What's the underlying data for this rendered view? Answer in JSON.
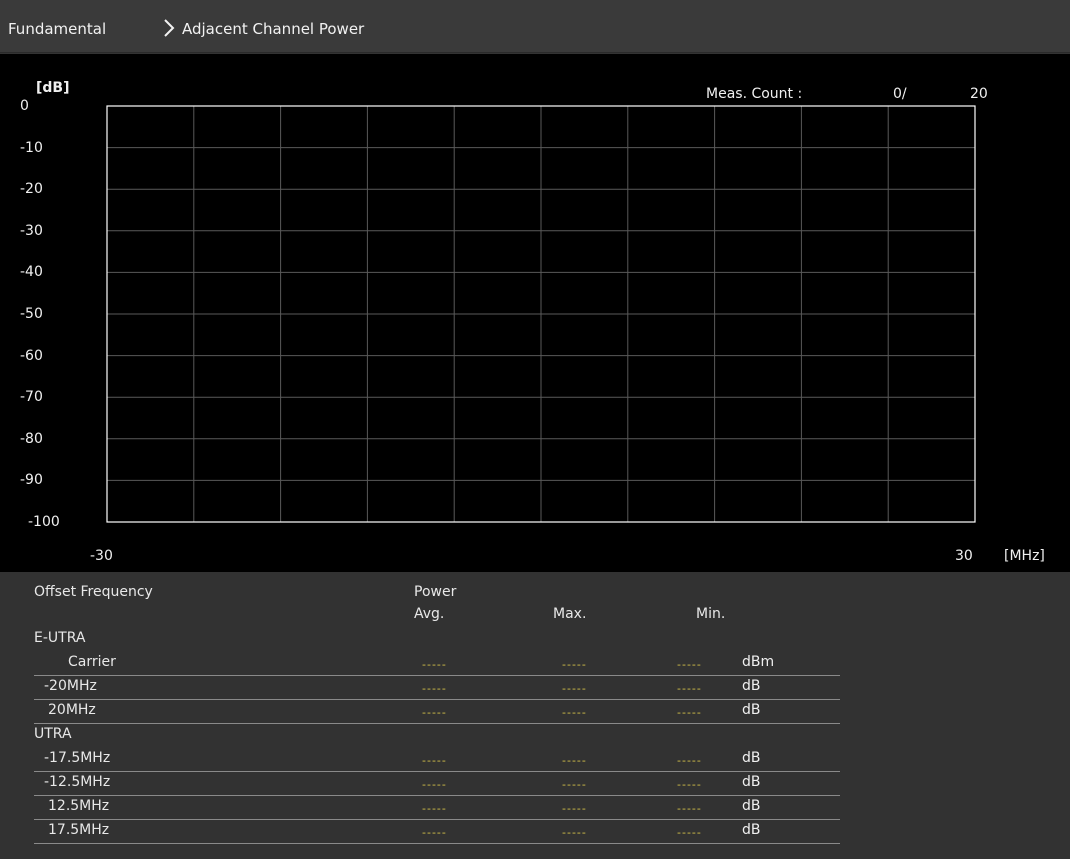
{
  "breadcrumb": {
    "items": [
      "Fundamental",
      "Adjacent Channel Power"
    ]
  },
  "graph": {
    "y_unit": "[dB]",
    "x_unit": "[MHz]",
    "meas_count_label": "Meas. Count :",
    "meas_count_current": "0/",
    "meas_count_total": "20",
    "y_ticks": [
      "0",
      "-10",
      "-20",
      "-30",
      "-40",
      "-50",
      "-60",
      "-70",
      "-80",
      "-90",
      "-100"
    ],
    "x_min_label": "-30",
    "x_max_label": "30",
    "colors": {
      "background": "#000000",
      "grid": "#5a5a5a",
      "frame": "#ffffff"
    }
  },
  "table": {
    "headers": {
      "offset_frequency": "Offset Frequency",
      "power": "Power",
      "avg": "Avg.",
      "max": "Max.",
      "min": "Min."
    },
    "groups": [
      {
        "label": "E-UTRA",
        "rows": [
          {
            "offset": "Carrier",
            "avg": "-----",
            "max": "-----",
            "min": "-----",
            "unit": "dBm"
          },
          {
            "offset": "-20MHz",
            "avg": "-----",
            "max": "-----",
            "min": "-----",
            "unit": "dB"
          },
          {
            "offset": "20MHz",
            "avg": "-----",
            "max": "-----",
            "min": "-----",
            "unit": "dB"
          }
        ]
      },
      {
        "label": "UTRA",
        "rows": [
          {
            "offset": "-17.5MHz",
            "avg": "-----",
            "max": "-----",
            "min": "-----",
            "unit": "dB"
          },
          {
            "offset": "-12.5MHz",
            "avg": "-----",
            "max": "-----",
            "min": "-----",
            "unit": "dB"
          },
          {
            "offset": "12.5MHz",
            "avg": "-----",
            "max": "-----",
            "min": "-----",
            "unit": "dB"
          },
          {
            "offset": "17.5MHz",
            "avg": "-----",
            "max": "-----",
            "min": "-----",
            "unit": "dB"
          }
        ]
      }
    ],
    "colors": {
      "value_placeholder": "#d8c44a",
      "divider": "#8a8a8a"
    }
  }
}
